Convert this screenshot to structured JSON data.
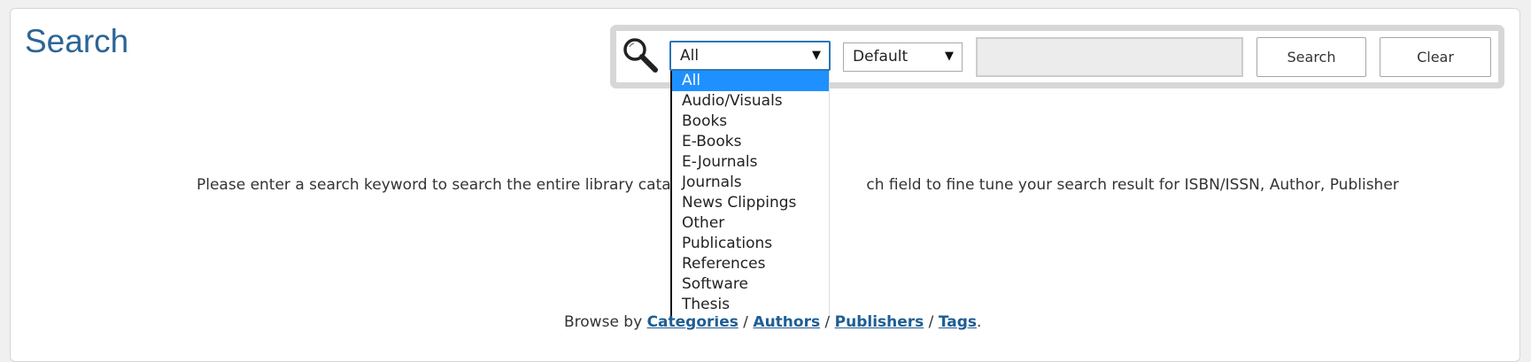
{
  "page": {
    "title": "Search"
  },
  "search": {
    "type_select": {
      "value": "All",
      "options": [
        "All",
        "Audio/Visuals",
        "Books",
        "E-Books",
        "E-Journals",
        "Journals",
        "News Clippings",
        "Other",
        "Publications",
        "References",
        "Software",
        "Thesis"
      ]
    },
    "sort_select": {
      "value": "Default"
    },
    "keyword": {
      "value": "",
      "placeholder": ""
    },
    "search_label": "Search",
    "clear_label": "Clear"
  },
  "help": {
    "text": "Please enter a search keyword to search the entire library catalog it",
    "text_tail": "ch field to fine tune your search result for ISBN/ISSN, Author, Publisher"
  },
  "browse": {
    "prefix": "Browse by ",
    "links": [
      "Categories",
      "Authors",
      "Publishers",
      "Tags"
    ],
    "separator": " / ",
    "suffix": "."
  },
  "colors": {
    "title": "#2c6596",
    "link": "#1f5e93",
    "selected_option": "#1e90ff",
    "focus_border": "#2a76b8"
  },
  "icons": {
    "search": "magnifier-icon",
    "dropdown_arrow": "triangle-down-icon"
  }
}
